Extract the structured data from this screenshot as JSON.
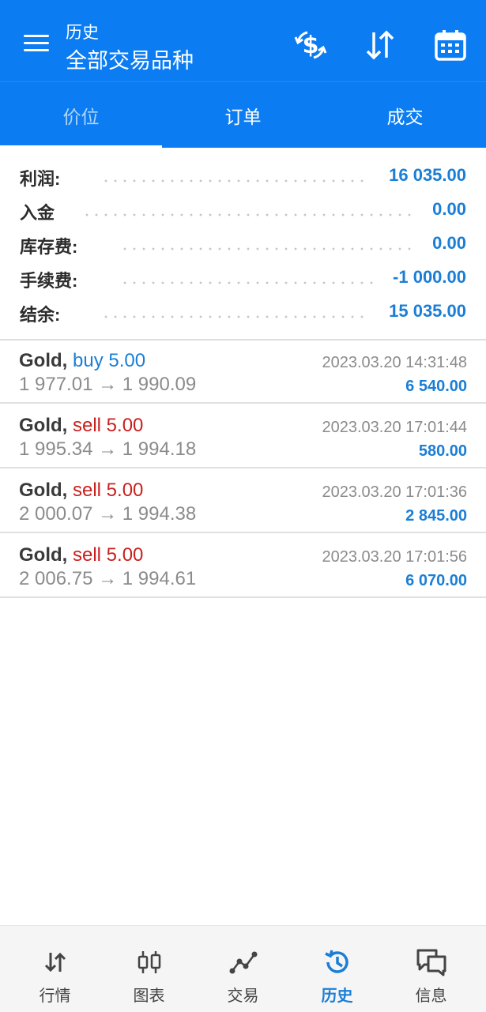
{
  "header": {
    "section": "历史",
    "title": "全部交易品种"
  },
  "icons": {
    "menu": "hamburger-icon",
    "currency": "currency-exchange-icon",
    "sort": "sort-arrows-icon",
    "calendar": "calendar-icon"
  },
  "tabs": [
    {
      "label": "价位",
      "active": true
    },
    {
      "label": "订单",
      "active": false
    },
    {
      "label": "成交",
      "active": false
    }
  ],
  "summary": [
    {
      "label": "利润:",
      "value": "16 035.00"
    },
    {
      "label": "入金",
      "value": "0.00"
    },
    {
      "label": "库存费:",
      "value": "0.00"
    },
    {
      "label": "手续费:",
      "value": "-1 000.00"
    },
    {
      "label": "结余:",
      "value": "15 035.00"
    }
  ],
  "deals": [
    {
      "symbol": "Gold,",
      "side": "buy 5.00",
      "side_type": "buy",
      "open": "1 977.01",
      "close": "1 990.09",
      "time": "2023.03.20 14:31:48",
      "profit": "6 540.00"
    },
    {
      "symbol": "Gold,",
      "side": "sell 5.00",
      "side_type": "sell",
      "open": "1 995.34",
      "close": "1 994.18",
      "time": "2023.03.20 17:01:44",
      "profit": "580.00"
    },
    {
      "symbol": "Gold,",
      "side": "sell 5.00",
      "side_type": "sell",
      "open": "2 000.07",
      "close": "1 994.38",
      "time": "2023.03.20 17:01:36",
      "profit": "2 845.00"
    },
    {
      "symbol": "Gold,",
      "side": "sell 5.00",
      "side_type": "sell",
      "open": "2 006.75",
      "close": "1 994.61",
      "time": "2023.03.20 17:01:56",
      "profit": "6 070.00"
    }
  ],
  "arrow": "→",
  "nav": [
    {
      "label": "行情",
      "icon": "quotes-icon",
      "active": false
    },
    {
      "label": "图表",
      "icon": "chart-candles-icon",
      "active": false
    },
    {
      "label": "交易",
      "icon": "trade-line-icon",
      "active": false
    },
    {
      "label": "历史",
      "icon": "history-icon",
      "active": true
    },
    {
      "label": "信息",
      "icon": "messages-icon",
      "active": false
    }
  ],
  "colors": {
    "primary": "#0b7cf2",
    "accent_blue": "#1a7ed6",
    "sell_red": "#c9201e",
    "muted": "#8b8b8b"
  }
}
